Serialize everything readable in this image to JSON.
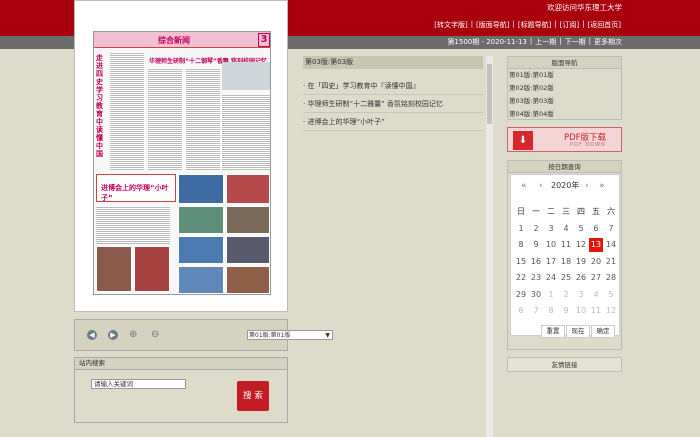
{
  "header": {
    "welcome": "欢迎访问华东理工大学",
    "nav": [
      "[转文字版]",
      "[版面导航]",
      "[标题导航]",
      "[订阅]",
      "[返回首页]"
    ],
    "issue": "第1500期 - 2020-11-13",
    "issue_links": [
      "上一期",
      "下一期",
      "更多期次"
    ],
    "separator": "|"
  },
  "paper": {
    "section": "综合新闻",
    "page_num": "3",
    "vertical_title": "走进四史学习教育中读懂中国",
    "headline": "华理师生研制“十二钢琴”香飘 铭刻校园记忆",
    "sub_headline": "进博会上的华理“小叶子”"
  },
  "controls": {
    "page_select": "第01版:第01版",
    "icons": [
      "prev-page-icon",
      "next-page-icon",
      "zoom-in-icon",
      "zoom-out-icon"
    ]
  },
  "search": {
    "title": "站内搜索",
    "placeholder": "请输入关键词",
    "button": "搜 索"
  },
  "articles": {
    "header": "第03版:第03版",
    "items": [
      "· 在「四史」学习教育中『读懂中国』",
      "· 华理师生研制“十二雅馨” 香氛铭刻校园记忆",
      "· 进博会上的华理“小叶子”"
    ]
  },
  "sidebar": {
    "nav_title": "版面导航",
    "pages": [
      "第01版:第01版",
      "第02版:第02版",
      "第03版:第03版",
      "第04版:第04版"
    ],
    "pdf_label": "PDF版下载",
    "pdf_sub": "PDF DOWN",
    "calendar_title": "按日期查询",
    "calendar": {
      "year": "2020年",
      "weekdays": [
        "日",
        "一",
        "二",
        "三",
        "四",
        "五",
        "六"
      ],
      "days": [
        [
          "1",
          "2",
          "3",
          "4",
          "5",
          "6",
          "7"
        ],
        [
          "8",
          "9",
          "10",
          "11",
          "12",
          "13",
          "14"
        ],
        [
          "15",
          "16",
          "17",
          "18",
          "19",
          "20",
          "21"
        ],
        [
          "22",
          "23",
          "24",
          "25",
          "26",
          "27",
          "28"
        ],
        [
          "29",
          "30",
          "1",
          "2",
          "3",
          "4",
          "5"
        ],
        [
          "6",
          "7",
          "8",
          "9",
          "10",
          "11",
          "12"
        ]
      ],
      "selected": "13",
      "buttons": [
        "重置",
        "现在",
        "确定"
      ]
    },
    "links_title": "友情链接"
  }
}
